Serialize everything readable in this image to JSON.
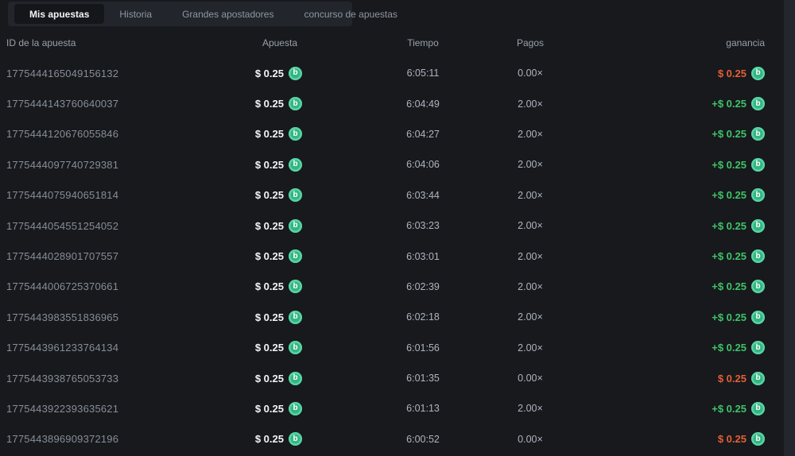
{
  "colors": {
    "page_background": "#17191d",
    "tabbar_background": "#22262c",
    "active_tab_background": "#14161a",
    "win_green": "#3ec468",
    "loss_orange": "#e55f35",
    "coin_green": "#35b483",
    "coin_ring": "#58d4a3"
  },
  "icons": {
    "coin_glyph": "b"
  },
  "tabs": [
    {
      "label": "Mis apuestas",
      "active": true
    },
    {
      "label": "Historia",
      "active": false
    },
    {
      "label": "Grandes apostadores",
      "active": false
    },
    {
      "label": "concurso de apuestas",
      "active": false
    }
  ],
  "table": {
    "columns": {
      "id": "ID de la apuesta",
      "bet": "Apuesta",
      "time": "Tiempo",
      "payout": "Pagos",
      "profit": "ganancia"
    },
    "rows": [
      {
        "id": "1775444165049156132",
        "bet": "$ 0.25",
        "time": "6:05:11",
        "payout": "0.00×",
        "profit": "$ 0.25",
        "result": "loss"
      },
      {
        "id": "1775444143760640037",
        "bet": "$ 0.25",
        "time": "6:04:49",
        "payout": "2.00×",
        "profit": "+$ 0.25",
        "result": "win"
      },
      {
        "id": "1775444120676055846",
        "bet": "$ 0.25",
        "time": "6:04:27",
        "payout": "2.00×",
        "profit": "+$ 0.25",
        "result": "win"
      },
      {
        "id": "1775444097740729381",
        "bet": "$ 0.25",
        "time": "6:04:06",
        "payout": "2.00×",
        "profit": "+$ 0.25",
        "result": "win"
      },
      {
        "id": "1775444075940651814",
        "bet": "$ 0.25",
        "time": "6:03:44",
        "payout": "2.00×",
        "profit": "+$ 0.25",
        "result": "win"
      },
      {
        "id": "1775444054551254052",
        "bet": "$ 0.25",
        "time": "6:03:23",
        "payout": "2.00×",
        "profit": "+$ 0.25",
        "result": "win"
      },
      {
        "id": "1775444028901707557",
        "bet": "$ 0.25",
        "time": "6:03:01",
        "payout": "2.00×",
        "profit": "+$ 0.25",
        "result": "win"
      },
      {
        "id": "1775444006725370661",
        "bet": "$ 0.25",
        "time": "6:02:39",
        "payout": "2.00×",
        "profit": "+$ 0.25",
        "result": "win"
      },
      {
        "id": "1775443983551836965",
        "bet": "$ 0.25",
        "time": "6:02:18",
        "payout": "2.00×",
        "profit": "+$ 0.25",
        "result": "win"
      },
      {
        "id": "1775443961233764134",
        "bet": "$ 0.25",
        "time": "6:01:56",
        "payout": "2.00×",
        "profit": "+$ 0.25",
        "result": "win"
      },
      {
        "id": "1775443938765053733",
        "bet": "$ 0.25",
        "time": "6:01:35",
        "payout": "0.00×",
        "profit": "$ 0.25",
        "result": "loss"
      },
      {
        "id": "1775443922393635621",
        "bet": "$ 0.25",
        "time": "6:01:13",
        "payout": "2.00×",
        "profit": "+$ 0.25",
        "result": "win"
      },
      {
        "id": "1775443896909372196",
        "bet": "$ 0.25",
        "time": "6:00:52",
        "payout": "0.00×",
        "profit": "$ 0.25",
        "result": "loss"
      }
    ]
  }
}
